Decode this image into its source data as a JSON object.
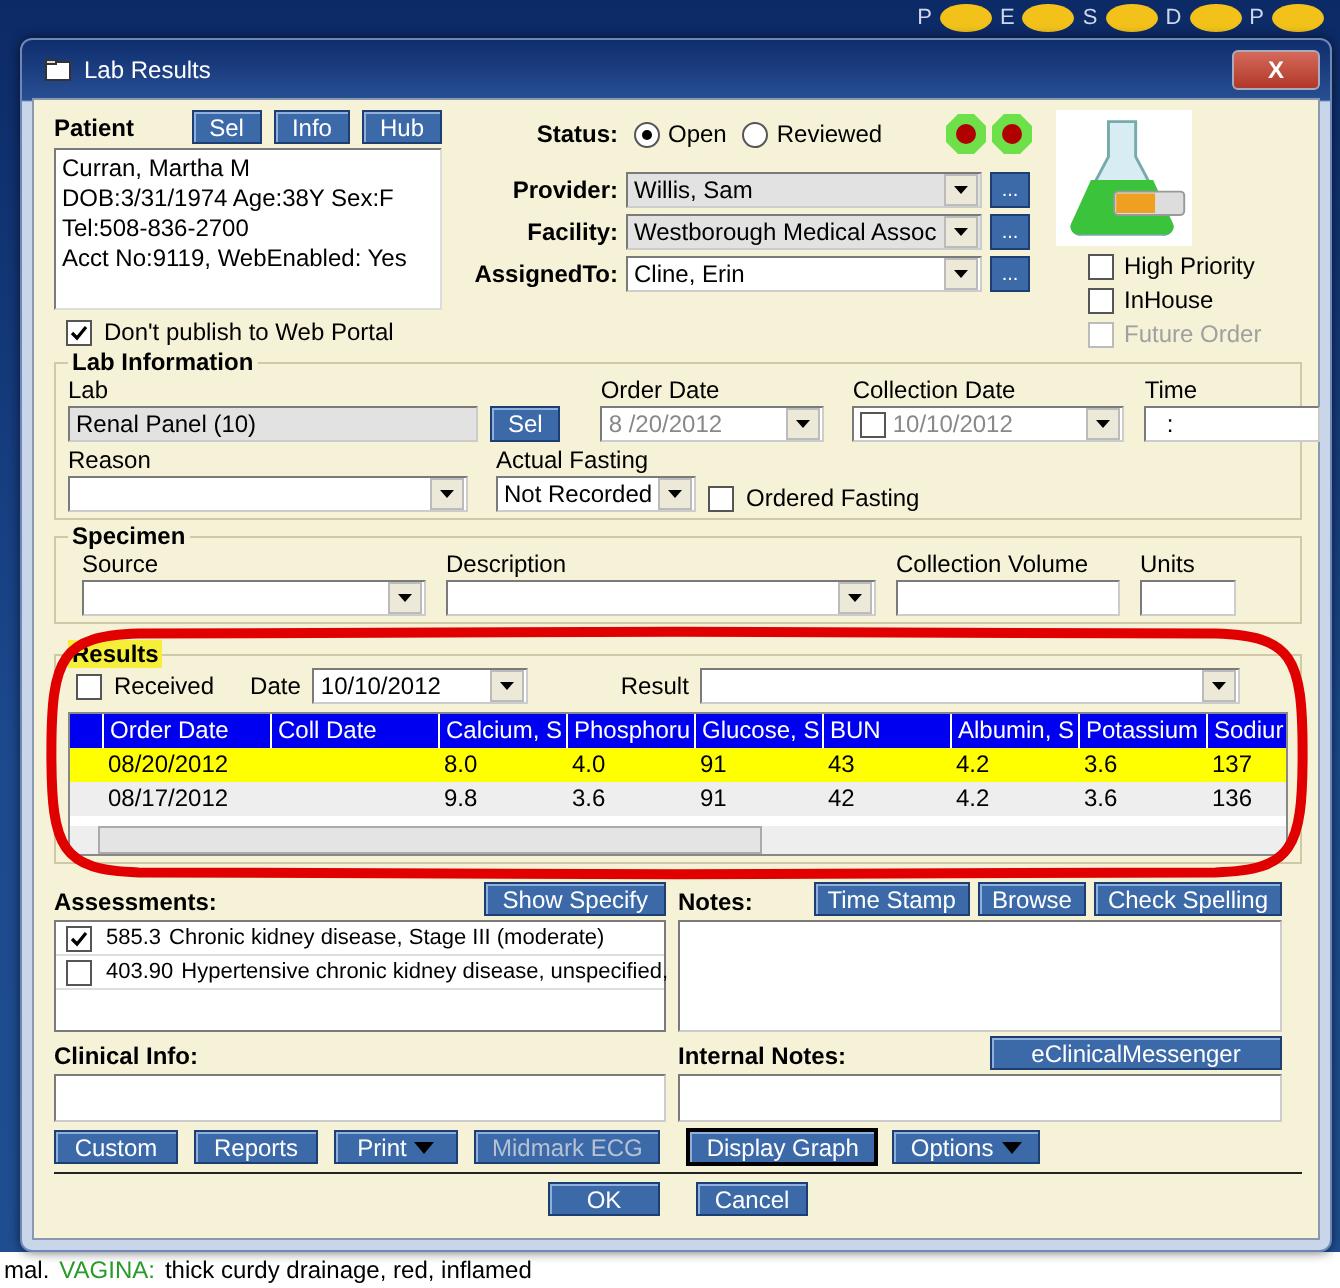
{
  "top_bar_letters": [
    "P",
    "E",
    "S",
    "D",
    "P"
  ],
  "window": {
    "title": "Lab Results",
    "close": "X"
  },
  "patient": {
    "label": "Patient",
    "buttons": [
      "Sel",
      "Info",
      "Hub"
    ],
    "lines": [
      "Curran, Martha M",
      "DOB:3/31/1974  Age:38Y  Sex:F",
      "Tel:508-836-2700",
      "Acct No:9119, WebEnabled: Yes"
    ],
    "dont_publish": {
      "label": "Don't publish to Web Portal",
      "checked": true
    }
  },
  "status": {
    "label": "Status:",
    "options": [
      {
        "label": "Open",
        "selected": true
      },
      {
        "label": "Reviewed",
        "selected": false
      }
    ]
  },
  "assignments": [
    {
      "label": "Provider:",
      "value": "Willis, Sam",
      "readonly": true,
      "more": "..."
    },
    {
      "label": "Facility:",
      "value": "Westborough Medical Assoc",
      "readonly": true,
      "more": "..."
    },
    {
      "label": "AssignedTo:",
      "value": "Cline, Erin",
      "readonly": false,
      "more": "..."
    }
  ],
  "flags": [
    {
      "label": "High Priority",
      "checked": false,
      "disabled": false
    },
    {
      "label": "InHouse",
      "checked": false,
      "disabled": false
    },
    {
      "label": "Future Order",
      "checked": false,
      "disabled": true
    }
  ],
  "lab_information": {
    "title": "Lab Information",
    "lab": {
      "label": "Lab",
      "value": "Renal Panel (10)",
      "button": "Sel"
    },
    "order_date": {
      "label": "Order Date",
      "value": "8 /20/2012",
      "disabled": true
    },
    "collection_date": {
      "label": "Collection Date",
      "value": "10/10/2012",
      "checked": false
    },
    "time": {
      "label": "Time",
      "value": ":"
    },
    "reason": {
      "label": "Reason"
    },
    "actual_fasting": {
      "label": "Actual Fasting",
      "value": "Not Recorded"
    },
    "ordered_fasting": {
      "label": "Ordered Fasting",
      "checked": false
    }
  },
  "specimen": {
    "title": "Specimen",
    "fields": [
      {
        "label": "Source",
        "kind": "select"
      },
      {
        "label": "Description",
        "kind": "select"
      },
      {
        "label": "Collection Volume",
        "kind": "text"
      },
      {
        "label": "Units",
        "kind": "text"
      }
    ]
  },
  "results": {
    "title": "Results",
    "received": {
      "label": "Received",
      "checked": false
    },
    "date": {
      "label": "Date",
      "value": "10/10/2012"
    },
    "result": {
      "label": "Result"
    },
    "table": {
      "columns": [
        "Order Date",
        "Coll Date",
        "Calcium, S",
        "Phosphoru",
        "Glucose, S",
        "BUN",
        "Albumin, S",
        "Potassium",
        "Sodiur"
      ],
      "rows": [
        {
          "selected": true,
          "cells": [
            "08/20/2012",
            "",
            "8.0",
            "4.0",
            "91",
            "43",
            "4.2",
            "3.6",
            "137"
          ]
        },
        {
          "selected": false,
          "cells": [
            "08/17/2012",
            "",
            "9.8",
            "3.6",
            "91",
            "42",
            "4.2",
            "3.6",
            "136"
          ]
        }
      ]
    }
  },
  "assessments": {
    "label": "Assessments:",
    "button": "Show Specify",
    "items": [
      {
        "code": "585.3",
        "text": "Chronic kidney disease, Stage III (moderate)",
        "checked": true
      },
      {
        "code": "403.90",
        "text": "Hypertensive chronic kidney disease, unspecified,",
        "checked": false
      }
    ]
  },
  "notes": {
    "label": "Notes:",
    "buttons": [
      "Time Stamp",
      "Browse",
      "Check Spelling"
    ]
  },
  "clinical_info": {
    "label": "Clinical Info:"
  },
  "internal_notes": {
    "label": "Internal Notes:",
    "button": "eClinicalMessenger"
  },
  "toolbar": [
    {
      "label": "Custom",
      "kind": "plain",
      "disabled": false,
      "focused": false
    },
    {
      "label": "Reports",
      "kind": "plain",
      "disabled": false,
      "focused": false
    },
    {
      "label": "Print",
      "kind": "menu",
      "disabled": false,
      "focused": false
    },
    {
      "label": "Midmark ECG",
      "kind": "plain",
      "disabled": true,
      "focused": false
    },
    {
      "label": "Display Graph",
      "kind": "plain",
      "disabled": false,
      "focused": true
    },
    {
      "label": "Options",
      "kind": "menu",
      "disabled": false,
      "focused": false
    }
  ],
  "footer_buttons": [
    "OK",
    "Cancel"
  ],
  "background_note": [
    {
      "text": "mal.",
      "kind": "plain"
    },
    {
      "text": "VAGINA:",
      "kind": "heading"
    },
    {
      "text": "thick curdy drainage, red, inflamed",
      "kind": "plain"
    }
  ]
}
